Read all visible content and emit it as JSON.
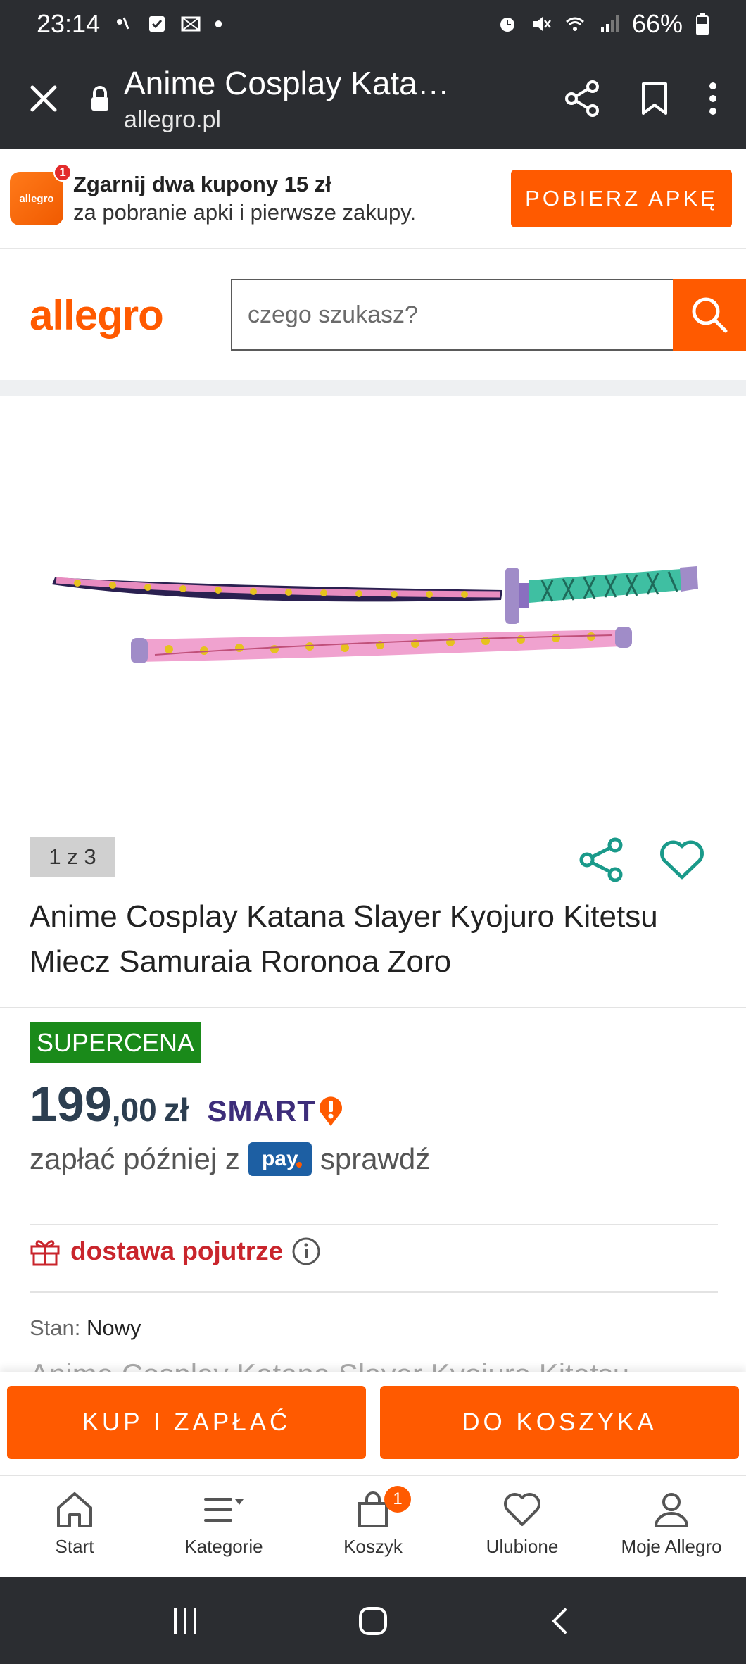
{
  "status_bar": {
    "time": "23:14",
    "battery": "66%"
  },
  "browser": {
    "title": "Anime Cosplay Katana Slayer Kyojuro",
    "url": "allegro.pl"
  },
  "promo": {
    "icon_text": "allegro",
    "badge": "1",
    "title": "Zgarnij dwa kupony 15 zł",
    "subtitle": "za pobranie apki i pierwsze zakupy.",
    "button": "POBIERZ APKĘ"
  },
  "header": {
    "logo": "allegro",
    "search_placeholder": "czego szukasz?"
  },
  "product": {
    "image_counter": "1 z 3",
    "title": "Anime Cosplay Katana Slayer Kyojuro Kitetsu Miecz Samuraia Roronoa Zoro",
    "badge": "SUPERCENA",
    "price_int": "199",
    "price_dec": ",00",
    "currency": "zł",
    "smart": "SMART",
    "pay_later_prefix": "zapłać później z",
    "pay_badge": "pay",
    "pay_later_suffix": "sprawdź",
    "delivery": "dostawa pojutrze",
    "condition_label": "Stan:",
    "condition_value": "Nowy",
    "ghost_text": "Anime Cosplay Katana Slayer Kyojuro Kitetsu"
  },
  "actions": {
    "buy": "KUP I ZAPŁAĆ",
    "add_to_cart": "DO KOSZYKA"
  },
  "bottom_nav": {
    "items": [
      {
        "label": "Start",
        "icon": "home-icon"
      },
      {
        "label": "Kategorie",
        "icon": "menu-icon"
      },
      {
        "label": "Koszyk",
        "icon": "bag-icon",
        "badge": "1"
      },
      {
        "label": "Ulubione",
        "icon": "heart-icon"
      },
      {
        "label": "Moje Allegro",
        "icon": "user-icon"
      }
    ]
  },
  "colors": {
    "brand": "#ff5a00",
    "supercena": "#1a8a1a",
    "delivery": "#c9252c",
    "share": "#1a9a8a",
    "dark_bar": "#2b2d31"
  }
}
